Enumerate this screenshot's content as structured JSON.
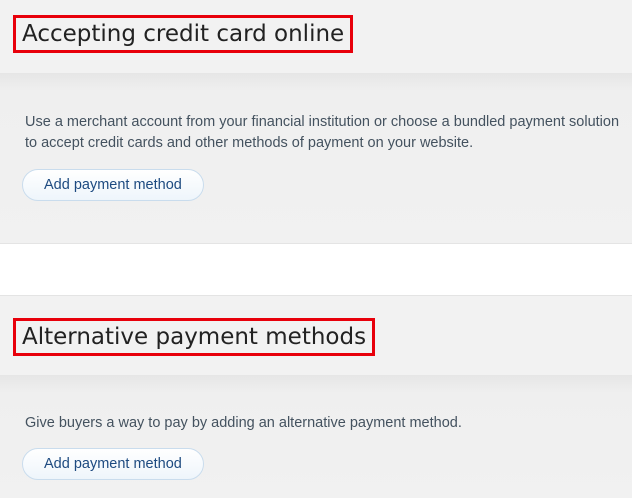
{
  "sections": [
    {
      "title": "Accepting credit card online",
      "description": "Use a merchant account from your financial institution or choose a bundled payment solution to accept credit cards and other methods of payment on your website.",
      "button_label": "Add payment method"
    },
    {
      "title": "Alternative payment methods",
      "description": "Give buyers a way to pay by adding an alternative payment method.",
      "button_label": "Add payment method"
    }
  ],
  "colors": {
    "highlight_border": "#e8000b",
    "button_text": "#1d4a80",
    "body_text": "#44525f"
  }
}
